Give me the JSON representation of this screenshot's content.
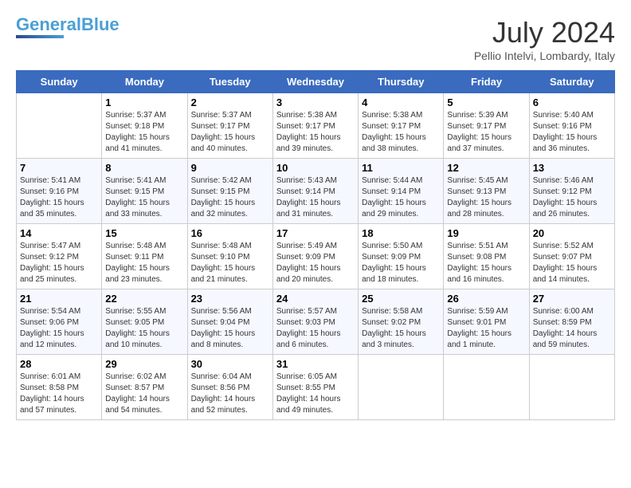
{
  "header": {
    "logo_line1": "General",
    "logo_line2": "Blue",
    "month_year": "July 2024",
    "location": "Pellio Intelvi, Lombardy, Italy"
  },
  "weekdays": [
    "Sunday",
    "Monday",
    "Tuesday",
    "Wednesday",
    "Thursday",
    "Friday",
    "Saturday"
  ],
  "weeks": [
    [
      {
        "day": "",
        "info": ""
      },
      {
        "day": "1",
        "info": "Sunrise: 5:37 AM\nSunset: 9:18 PM\nDaylight: 15 hours\nand 41 minutes."
      },
      {
        "day": "2",
        "info": "Sunrise: 5:37 AM\nSunset: 9:17 PM\nDaylight: 15 hours\nand 40 minutes."
      },
      {
        "day": "3",
        "info": "Sunrise: 5:38 AM\nSunset: 9:17 PM\nDaylight: 15 hours\nand 39 minutes."
      },
      {
        "day": "4",
        "info": "Sunrise: 5:38 AM\nSunset: 9:17 PM\nDaylight: 15 hours\nand 38 minutes."
      },
      {
        "day": "5",
        "info": "Sunrise: 5:39 AM\nSunset: 9:17 PM\nDaylight: 15 hours\nand 37 minutes."
      },
      {
        "day": "6",
        "info": "Sunrise: 5:40 AM\nSunset: 9:16 PM\nDaylight: 15 hours\nand 36 minutes."
      }
    ],
    [
      {
        "day": "7",
        "info": "Sunrise: 5:41 AM\nSunset: 9:16 PM\nDaylight: 15 hours\nand 35 minutes."
      },
      {
        "day": "8",
        "info": "Sunrise: 5:41 AM\nSunset: 9:15 PM\nDaylight: 15 hours\nand 33 minutes."
      },
      {
        "day": "9",
        "info": "Sunrise: 5:42 AM\nSunset: 9:15 PM\nDaylight: 15 hours\nand 32 minutes."
      },
      {
        "day": "10",
        "info": "Sunrise: 5:43 AM\nSunset: 9:14 PM\nDaylight: 15 hours\nand 31 minutes."
      },
      {
        "day": "11",
        "info": "Sunrise: 5:44 AM\nSunset: 9:14 PM\nDaylight: 15 hours\nand 29 minutes."
      },
      {
        "day": "12",
        "info": "Sunrise: 5:45 AM\nSunset: 9:13 PM\nDaylight: 15 hours\nand 28 minutes."
      },
      {
        "day": "13",
        "info": "Sunrise: 5:46 AM\nSunset: 9:12 PM\nDaylight: 15 hours\nand 26 minutes."
      }
    ],
    [
      {
        "day": "14",
        "info": "Sunrise: 5:47 AM\nSunset: 9:12 PM\nDaylight: 15 hours\nand 25 minutes."
      },
      {
        "day": "15",
        "info": "Sunrise: 5:48 AM\nSunset: 9:11 PM\nDaylight: 15 hours\nand 23 minutes."
      },
      {
        "day": "16",
        "info": "Sunrise: 5:48 AM\nSunset: 9:10 PM\nDaylight: 15 hours\nand 21 minutes."
      },
      {
        "day": "17",
        "info": "Sunrise: 5:49 AM\nSunset: 9:09 PM\nDaylight: 15 hours\nand 20 minutes."
      },
      {
        "day": "18",
        "info": "Sunrise: 5:50 AM\nSunset: 9:09 PM\nDaylight: 15 hours\nand 18 minutes."
      },
      {
        "day": "19",
        "info": "Sunrise: 5:51 AM\nSunset: 9:08 PM\nDaylight: 15 hours\nand 16 minutes."
      },
      {
        "day": "20",
        "info": "Sunrise: 5:52 AM\nSunset: 9:07 PM\nDaylight: 15 hours\nand 14 minutes."
      }
    ],
    [
      {
        "day": "21",
        "info": "Sunrise: 5:54 AM\nSunset: 9:06 PM\nDaylight: 15 hours\nand 12 minutes."
      },
      {
        "day": "22",
        "info": "Sunrise: 5:55 AM\nSunset: 9:05 PM\nDaylight: 15 hours\nand 10 minutes."
      },
      {
        "day": "23",
        "info": "Sunrise: 5:56 AM\nSunset: 9:04 PM\nDaylight: 15 hours\nand 8 minutes."
      },
      {
        "day": "24",
        "info": "Sunrise: 5:57 AM\nSunset: 9:03 PM\nDaylight: 15 hours\nand 6 minutes."
      },
      {
        "day": "25",
        "info": "Sunrise: 5:58 AM\nSunset: 9:02 PM\nDaylight: 15 hours\nand 3 minutes."
      },
      {
        "day": "26",
        "info": "Sunrise: 5:59 AM\nSunset: 9:01 PM\nDaylight: 15 hours\nand 1 minute."
      },
      {
        "day": "27",
        "info": "Sunrise: 6:00 AM\nSunset: 8:59 PM\nDaylight: 14 hours\nand 59 minutes."
      }
    ],
    [
      {
        "day": "28",
        "info": "Sunrise: 6:01 AM\nSunset: 8:58 PM\nDaylight: 14 hours\nand 57 minutes."
      },
      {
        "day": "29",
        "info": "Sunrise: 6:02 AM\nSunset: 8:57 PM\nDaylight: 14 hours\nand 54 minutes."
      },
      {
        "day": "30",
        "info": "Sunrise: 6:04 AM\nSunset: 8:56 PM\nDaylight: 14 hours\nand 52 minutes."
      },
      {
        "day": "31",
        "info": "Sunrise: 6:05 AM\nSunset: 8:55 PM\nDaylight: 14 hours\nand 49 minutes."
      },
      {
        "day": "",
        "info": ""
      },
      {
        "day": "",
        "info": ""
      },
      {
        "day": "",
        "info": ""
      }
    ]
  ]
}
